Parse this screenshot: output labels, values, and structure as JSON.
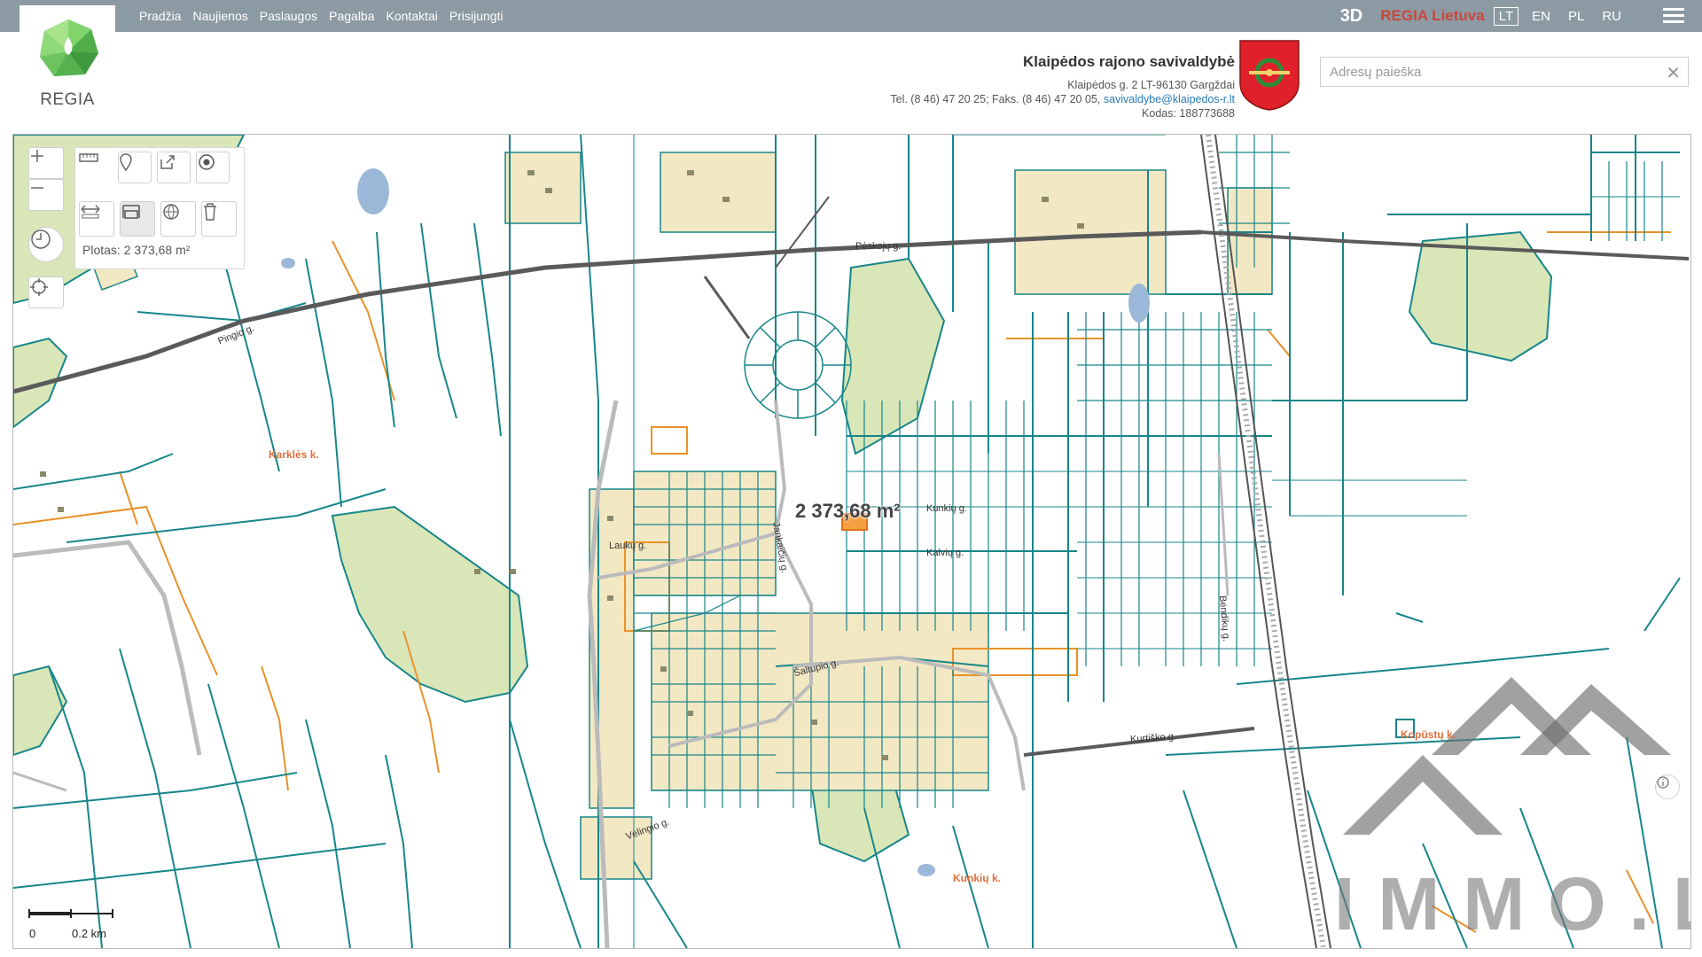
{
  "nav": {
    "items": [
      "Pradžia",
      "Naujienos",
      "Paslaugos",
      "Pagalba",
      "Kontaktai",
      "Prisijungti"
    ],
    "btn3d": "3D",
    "regia_lt": "REGIA Lietuva",
    "langs": [
      "LT",
      "EN",
      "PL",
      "RU"
    ],
    "selected_lang": "LT"
  },
  "logo": {
    "text": "REGIA"
  },
  "municipality": {
    "name": "Klaipėdos rajono savivaldybė",
    "address": "Klaipėdos g. 2 LT-96130 Gargždai",
    "phone": "Tel. (8 46) 47 20 25; Faks. (8 46) 47 20 05,",
    "email": "savivaldybe@klaipedos-r.lt",
    "code": "Kodas: 188773688"
  },
  "search": {
    "placeholder": "Adresų paieška",
    "value": ""
  },
  "tools": {
    "plotas": "Plotas: 2 373,68 m²"
  },
  "scale": {
    "start": "0",
    "end": "0.2 km"
  },
  "map_labels": {
    "area_measure": "2 373,68 m²",
    "places": [
      "Karklės k.",
      "Kopūstų k.",
      "Kunkių k."
    ],
    "streets": [
      "Pėskojų g.",
      "Pingio g.",
      "Laukų g.",
      "Kunkių g.",
      "Kalvių g.",
      "Šaltupio g.",
      "Bendikų g.",
      "Kurtiško g.",
      "Vėlingio g.",
      "Jankaičių g."
    ]
  },
  "watermark": {
    "text": "IMMO.LT"
  },
  "colors": {
    "topbar": "#8c9aa4",
    "parcel": "#17868a",
    "road": "#5a5a5a",
    "orange": "#e8922a",
    "green_area": "#d9e6b8",
    "building_area": "#f3e8c4"
  }
}
